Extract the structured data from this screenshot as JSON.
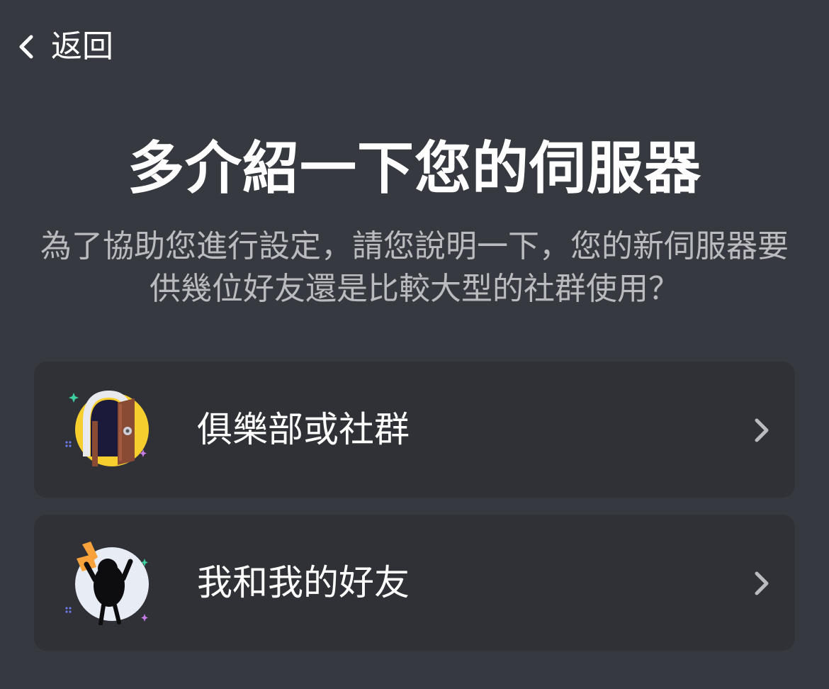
{
  "header": {
    "back_label": "返回"
  },
  "main": {
    "title": "多介紹一下您的伺服器",
    "subtitle": "為了協助您進行設定，請您說明一下，您的新伺服器要供幾位好友還是比較大型的社群使用？"
  },
  "options": [
    {
      "label": "俱樂部或社群",
      "icon": "club-door-illustration"
    },
    {
      "label": "我和我的好友",
      "icon": "friends-illustration"
    }
  ],
  "colors": {
    "background": "#36393f",
    "card": "#2f3136",
    "title": "#ffffff",
    "subtitle": "#b9bbbe",
    "chevron": "#b9bbbe"
  }
}
